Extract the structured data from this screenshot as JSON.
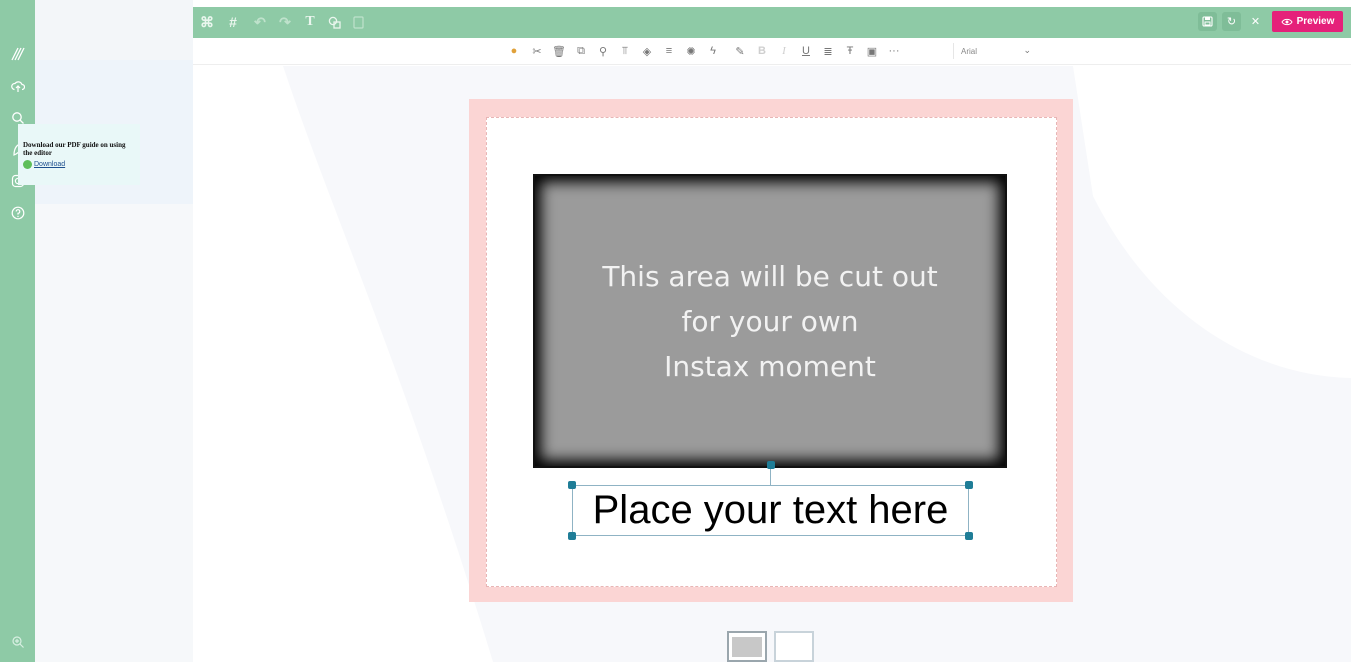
{
  "app": {
    "top_tools": [
      {
        "icon": "select-all-icon"
      },
      {
        "icon": "grid-icon"
      },
      {
        "icon": "undo-icon"
      },
      {
        "icon": "redo-icon"
      },
      {
        "icon": "text-icon"
      },
      {
        "icon": "shapes-icon"
      },
      {
        "icon": "page-icon"
      }
    ],
    "right_actions": [
      {
        "icon": "save-icon"
      },
      {
        "icon": "refresh-icon"
      },
      {
        "icon": "close-icon"
      }
    ],
    "preview_label": "Preview",
    "accent_color": "#e5217a",
    "brand_color": "#8ecaa6"
  },
  "rail": {
    "items": [
      {
        "icon": "pattern-icon"
      },
      {
        "icon": "upload-cloud-icon"
      },
      {
        "icon": "search-icon"
      },
      {
        "icon": "leaf-icon"
      },
      {
        "icon": "instagram-icon"
      },
      {
        "icon": "help-icon"
      }
    ],
    "bottom_icon": "zoom-icon"
  },
  "guide": {
    "text": "Download our PDF guide on using the editor",
    "link": "Download"
  },
  "format_toolbar": {
    "items": [
      {
        "icon": "fill-color-icon"
      },
      {
        "icon": "cut-icon"
      },
      {
        "icon": "delete-icon"
      },
      {
        "icon": "duplicate-icon"
      },
      {
        "icon": "format-painter-icon"
      },
      {
        "icon": "align-top-icon"
      },
      {
        "icon": "layers-icon"
      },
      {
        "icon": "align-icon"
      },
      {
        "icon": "effects-icon"
      },
      {
        "icon": "flash-icon"
      },
      {
        "icon": "pen-icon"
      },
      {
        "icon": "bold-icon"
      },
      {
        "icon": "italic-icon"
      },
      {
        "icon": "underline-icon"
      },
      {
        "icon": "text-align-icon"
      },
      {
        "icon": "text-size-icon"
      },
      {
        "icon": "text-frame-icon"
      },
      {
        "icon": "more-icon"
      }
    ],
    "font": "Arial"
  },
  "design": {
    "cutout_lines": [
      "This area will be cut out",
      "for your own",
      "Instax moment"
    ],
    "text_box": "Place your text here"
  },
  "pages": {
    "count": 2,
    "active_index": 0
  }
}
